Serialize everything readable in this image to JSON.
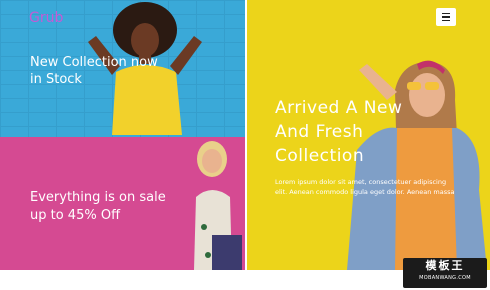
{
  "header": {
    "brand": "Grub",
    "menu_icon": "hamburger-icon"
  },
  "tiles": [
    {
      "title": "New Collection now in Stock",
      "bg": "#3aa9d8"
    },
    {
      "title": "Everything is on sale up to 45% Off",
      "bg": "#d54a92"
    },
    {
      "title": "Arrived A New And Fresh Collection",
      "body": "Lorem ipsum dolor sit amet, consectetuer adipiscing elit. Aenean commodo ligula eget dolor. Aenean massa",
      "bg": "#ecd41a"
    }
  ],
  "watermark": {
    "name": "模板王",
    "url": "MOBANWANG.COM"
  }
}
